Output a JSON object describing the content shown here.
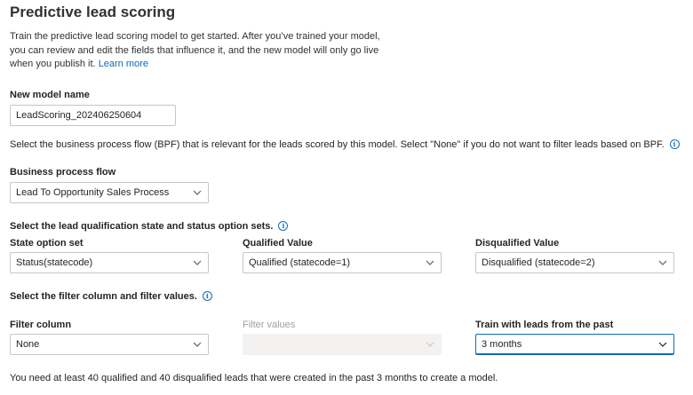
{
  "page": {
    "title": "Predictive lead scoring",
    "intro_text": "Train the predictive lead scoring model to get started. After you’ve trained your model, you can review and edit the fields that influence it, and the new model will only go live when you publish it.",
    "learn_more": "Learn more"
  },
  "model_name": {
    "label": "New model name",
    "value": "LeadScoring_202406250604"
  },
  "bpf": {
    "instruction": "Select the business process flow (BPF) that is relevant for the leads scored by this model. Select \"None\" if you do not want to filter leads based on BPF.",
    "label": "Business process flow",
    "value": "Lead To Opportunity Sales Process"
  },
  "qualification": {
    "instruction": "Select the lead qualification state and status option sets.",
    "state": {
      "label": "State option set",
      "value": "Status(statecode)"
    },
    "qualified": {
      "label": "Qualified Value",
      "value": "Qualified (statecode=1)"
    },
    "disqualified": {
      "label": "Disqualified Value",
      "value": "Disqualified (statecode=2)"
    }
  },
  "filter": {
    "instruction": "Select the filter column and filter values.",
    "column": {
      "label": "Filter column",
      "value": "None"
    },
    "values": {
      "label": "Filter values",
      "value": ""
    },
    "train_past": {
      "label": "Train with leads from the past",
      "value": "3 months"
    }
  },
  "footer_note": "You need at least 40 qualified and 40 disqualified leads that were created in the past 3 months to create a model.",
  "colors": {
    "accent": "#0f6cbd",
    "border": "#c8c6c4",
    "disabled_bg": "#f3f2f1"
  },
  "icons": {
    "info": "info-icon",
    "dropdown": "chevron-down-icon"
  }
}
